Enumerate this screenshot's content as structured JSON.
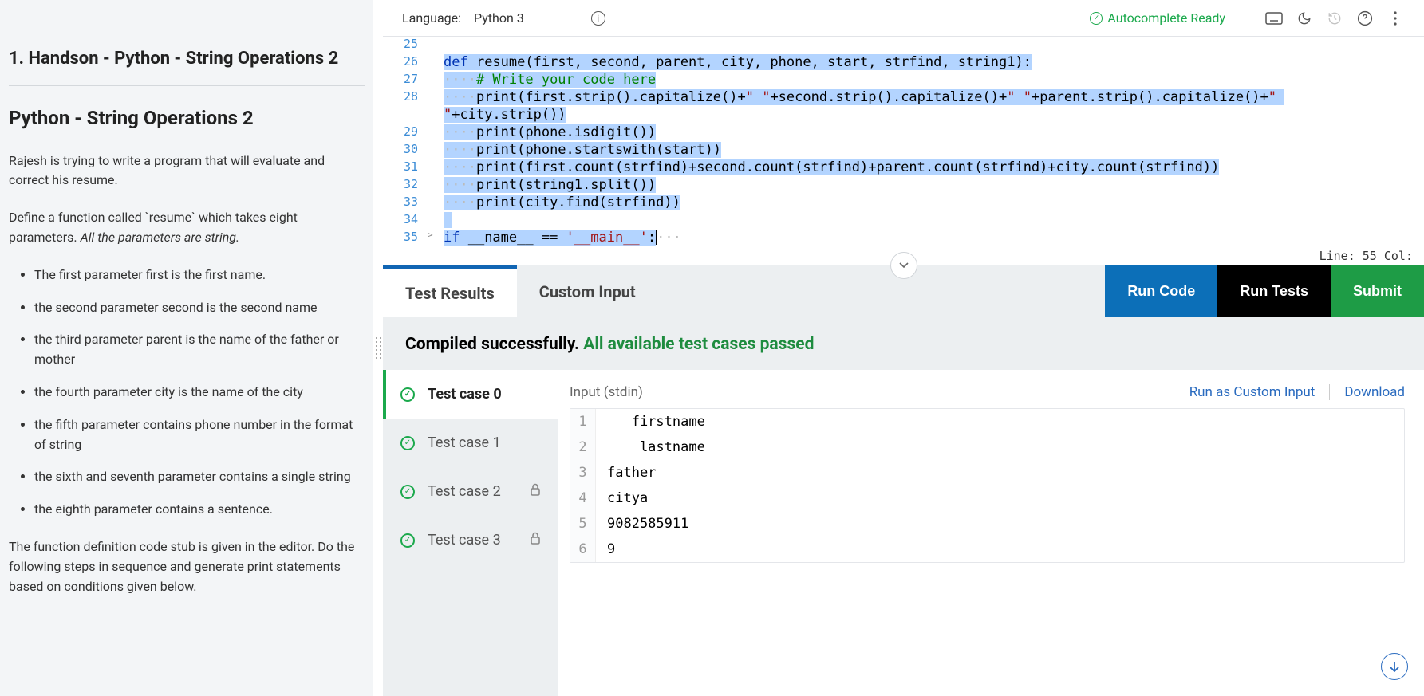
{
  "question": {
    "title": "1. Handson - Python - String Operations 2",
    "subtitle": "Python - String Operations 2",
    "intro1": "Rajesh is trying to write a program that will evaluate and correct his resume.",
    "intro2_pre": "Define a function called `resume` which takes eight parameters. ",
    "intro2_emph": "All the  parameters are string.",
    "bullets": [
      "The first parameter first is the first name.",
      "the second parameter second is the second name",
      "the third parameter parent is the name of the father or mother",
      "the fourth parameter city is the name of the city",
      "the fifth parameter contains phone number in the format of string",
      "the sixth and seventh parameter contains a single string",
      "the eighth parameter contains a sentence."
    ],
    "outro": "The function definition code stub is given in the editor. Do the following steps in sequence and generate print statements  based on conditions given below."
  },
  "topbar": {
    "lang_label": "Language:",
    "lang_value": "Python 3",
    "autocomplete": "Autocomplete Ready"
  },
  "editor": {
    "lines": [
      {
        "n": 25,
        "html": ""
      },
      {
        "n": 26,
        "html": "<span class='kw'>def</span> resume(first, second, parent, city, phone, start, strfind, string1):"
      },
      {
        "n": 27,
        "html": "    <span class='comment'># Write your code here</span>"
      },
      {
        "n": 28,
        "html": "    print(first.strip().capitalize()+<span class='str'>\" \"</span>+second.strip().capitalize()+<span class='str'>\" \"</span>+parent.strip().capitalize()+<span class='str'>\" \"</span>+city.strip())",
        "wrap": true
      },
      {
        "n": 29,
        "html": "    print(phone.isdigit())"
      },
      {
        "n": 30,
        "html": "    print(phone.startswith(start))"
      },
      {
        "n": 31,
        "html": "    print(first.count(strfind)+second.count(strfind)+parent.count(strfind)+city.count(strfind))"
      },
      {
        "n": 32,
        "html": "    print(string1.split())"
      },
      {
        "n": 33,
        "html": "    print(city.find(strfind))"
      },
      {
        "n": 34,
        "html": " ",
        "nosel": true
      },
      {
        "n": 35,
        "html": "<span class='kw'>if</span> __name__ == <span class='str'>'__main__'</span>:",
        "fold": true,
        "cursor": true
      }
    ],
    "status": "Line: 55 Col:"
  },
  "tabs": {
    "results": "Test Results",
    "custom": "Custom Input"
  },
  "actions": {
    "run": "Run Code",
    "test": "Run Tests",
    "submit": "Submit"
  },
  "compile": {
    "prefix": "Compiled successfully. ",
    "success": "All available test cases passed"
  },
  "testcases": [
    {
      "label": "Test case 0",
      "active": true,
      "locked": false
    },
    {
      "label": "Test case 1",
      "active": false,
      "locked": false
    },
    {
      "label": "Test case 2",
      "active": false,
      "locked": true
    },
    {
      "label": "Test case 3",
      "active": false,
      "locked": true
    }
  ],
  "io": {
    "label": "Input (stdin)",
    "link_custom": "Run as Custom Input",
    "link_download": "Download",
    "stdin": [
      "   firstname",
      "    lastname",
      "father",
      "citya",
      "9082585911",
      "9"
    ]
  }
}
